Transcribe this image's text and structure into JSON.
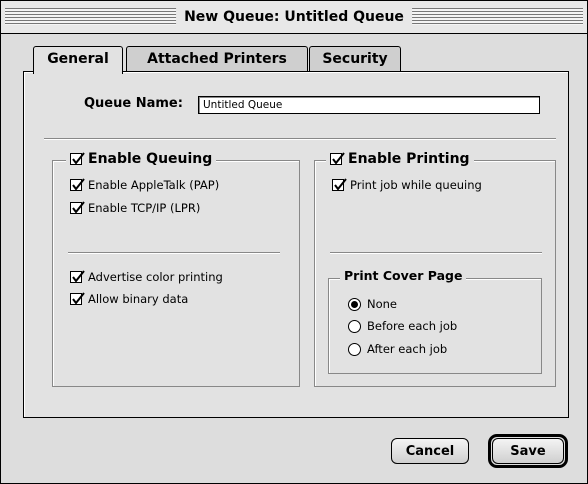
{
  "window": {
    "title": "New Queue: Untitled Queue"
  },
  "tabs": [
    {
      "label": "General",
      "active": true
    },
    {
      "label": "Attached Printers",
      "active": false
    },
    {
      "label": "Security",
      "active": false
    }
  ],
  "queue_name": {
    "label": "Queue Name:",
    "value": "Untitled Queue"
  },
  "queuing": {
    "title": "Enable Queuing",
    "checked": true,
    "options": [
      {
        "label": "Enable AppleTalk (PAP)",
        "checked": true
      },
      {
        "label": "Enable TCP/IP (LPR)",
        "checked": true
      }
    ],
    "extras": [
      {
        "label": "Advertise color printing",
        "checked": true
      },
      {
        "label": "Allow binary data",
        "checked": true
      }
    ]
  },
  "printing": {
    "title": "Enable Printing",
    "checked": true,
    "options": [
      {
        "label": "Print job while queuing",
        "checked": true
      }
    ]
  },
  "cover_page": {
    "title": "Print Cover Page",
    "options": [
      {
        "label": "None",
        "selected": true
      },
      {
        "label": "Before each job",
        "selected": false
      },
      {
        "label": "After each job",
        "selected": false
      }
    ]
  },
  "buttons": {
    "cancel": "Cancel",
    "save": "Save"
  }
}
